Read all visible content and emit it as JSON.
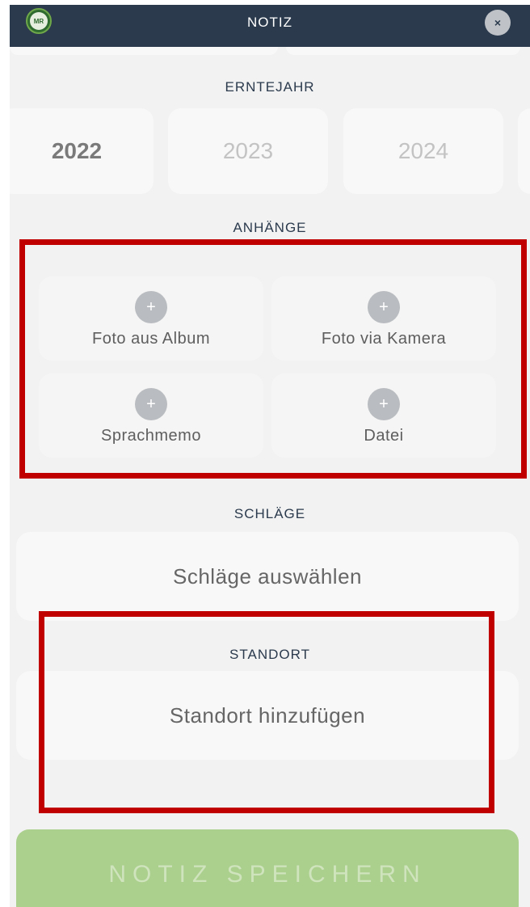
{
  "header": {
    "logo_text": "MR",
    "title": "NOTIZ",
    "close_glyph": "×"
  },
  "harvest_year": {
    "label": "ERNTEJAHR",
    "years": [
      {
        "label": "2022",
        "selected": true
      },
      {
        "label": "2023",
        "selected": false
      },
      {
        "label": "2024",
        "selected": false
      }
    ]
  },
  "attachments": {
    "label": "ANHÄNGE",
    "plus_glyph": "+",
    "items": [
      {
        "label": "Foto aus Album",
        "icon": "plus-icon"
      },
      {
        "label": "Foto via Kamera",
        "icon": "plus-icon"
      },
      {
        "label": "Sprachmemo",
        "icon": "plus-icon"
      },
      {
        "label": "Datei",
        "icon": "plus-icon"
      }
    ]
  },
  "fields": {
    "fields_label": "SCHLÄGE",
    "fields_placeholder": "Schläge auswählen"
  },
  "location": {
    "label": "STANDORT",
    "placeholder": "Standort hinzufügen"
  },
  "save_button": {
    "label": "NOTIZ SPEICHERN"
  },
  "colors": {
    "header_bg": "#2b3a4d",
    "save_button_bg": "#abcf8d",
    "highlight": "#c00000"
  }
}
